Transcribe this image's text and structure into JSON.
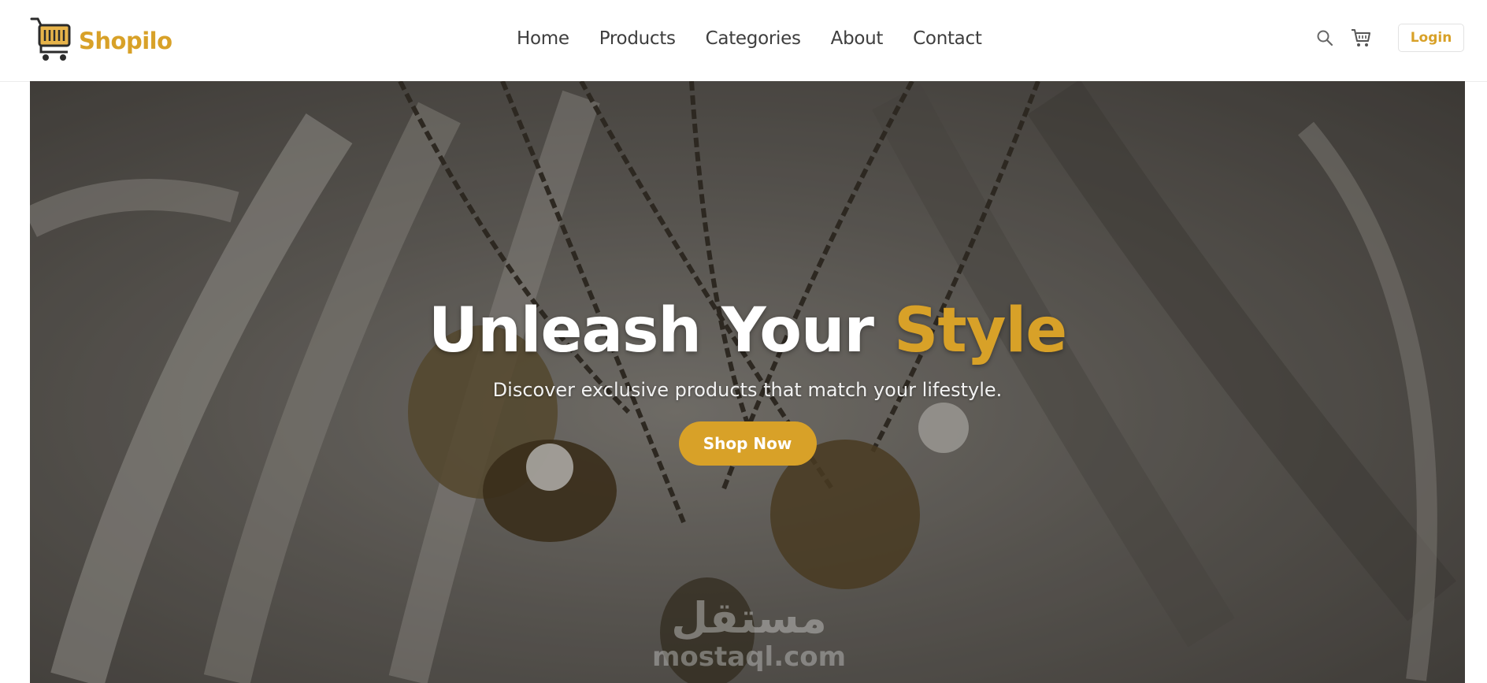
{
  "brand": {
    "name": "Shopilo"
  },
  "nav": {
    "items": [
      "Home",
      "Products",
      "Categories",
      "About",
      "Contact"
    ]
  },
  "header": {
    "login_label": "Login"
  },
  "hero": {
    "title_main": "Unleash Your ",
    "title_accent": "Style",
    "subtitle": "Discover exclusive products that match your lifestyle.",
    "cta_label": "Shop Now"
  },
  "watermark": {
    "arabic": "مستقل",
    "latin": "mostaql.com"
  },
  "colors": {
    "accent": "#d8a128",
    "nav_text": "#3e3e3e"
  },
  "icons": {
    "logo": "shopping-cart-logo-icon",
    "search": "search-icon",
    "cart": "cart-icon"
  }
}
